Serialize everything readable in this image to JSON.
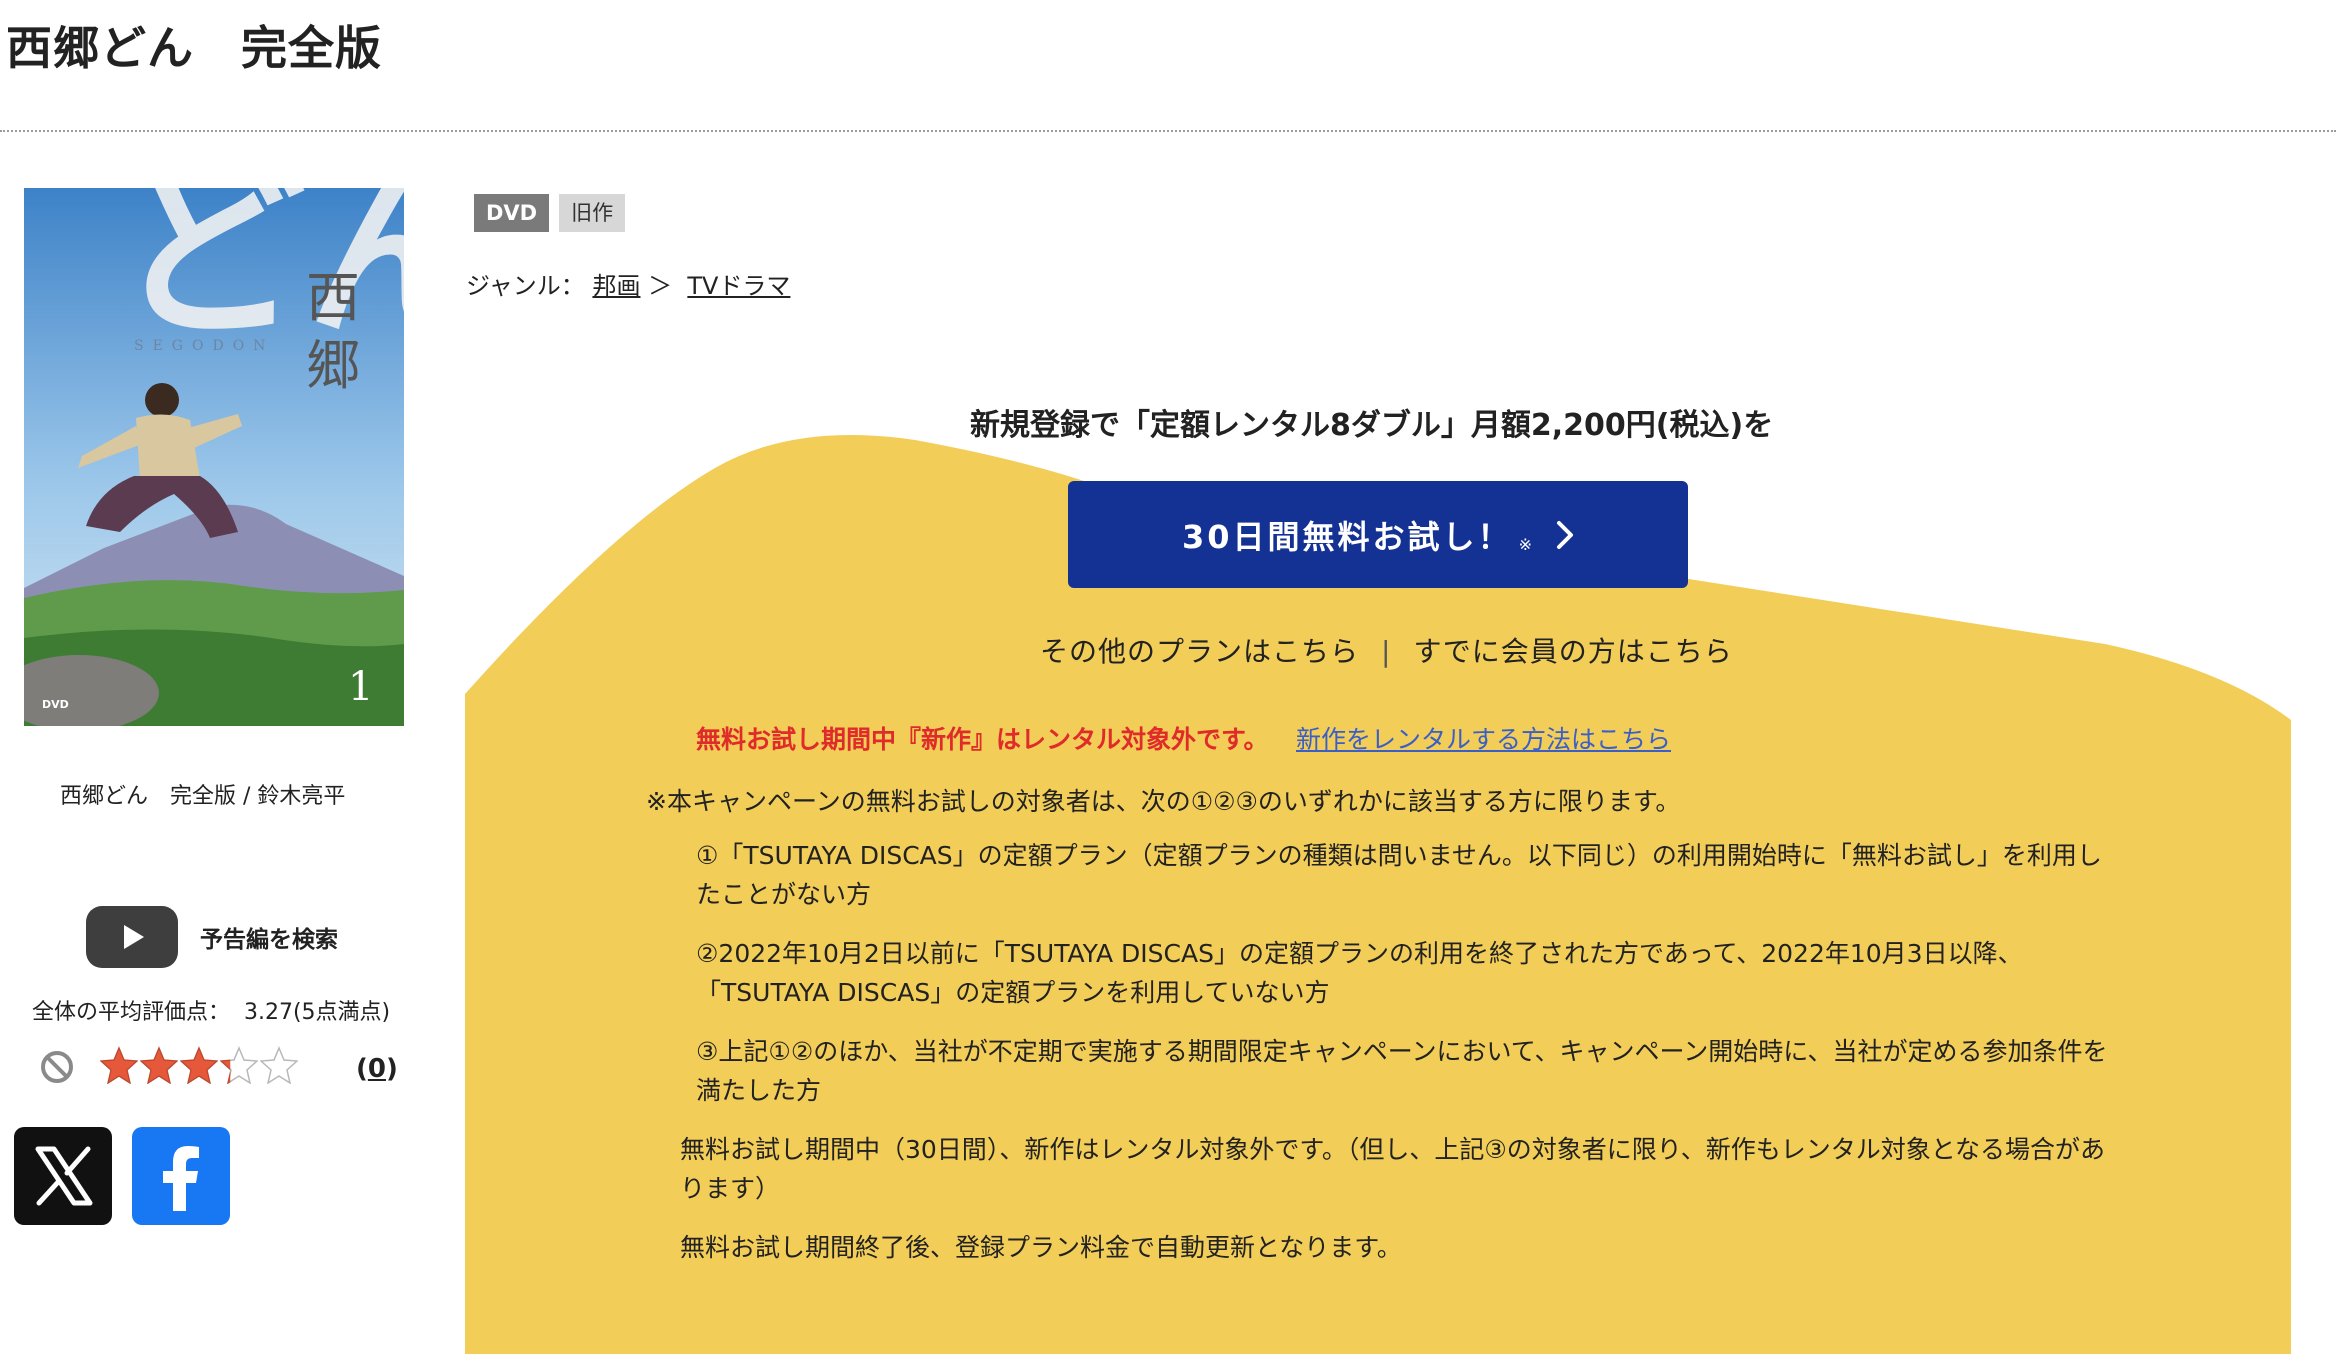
{
  "product": {
    "title": "西郷どん　完全版",
    "caption": "西郷どん　完全版 / 鈴木亮平",
    "cover": {
      "art_text_large": "どん",
      "art_text_vertical": [
        "西",
        "郷"
      ],
      "art_text_roman": "SEGODON",
      "volume": "1",
      "format_mark": "DVD"
    },
    "badges": [
      "DVD",
      "旧作"
    ]
  },
  "genre": {
    "label": "ジャンル：",
    "items": [
      "邦画",
      "TVドラマ"
    ],
    "separator": "＞"
  },
  "trailer": {
    "label": "予告編を検索"
  },
  "rating": {
    "line": "全体の平均評価点：  3.27(5点満点)",
    "value": 3.27,
    "max": 5,
    "review_count": "0"
  },
  "promo": {
    "headline": "新規登録で「定額レンタル8ダブル」月額2,200円(税込)を",
    "cta_label": "30日間無料お試し！",
    "cta_note": "※",
    "other_plans_link": "その他のプランはこちら",
    "separator": "|",
    "member_link": "すでに会員の方はこちら",
    "notice_red": "無料お試し期間中『新作』はレンタル対象外です。",
    "notice_link": "新作をレンタルする方法はこちら",
    "campaign_note": "※本キャンペーンの無料お試しの対象者は、次の①②③のいずれかに該当する方に限ります。",
    "conditions": [
      "①「TSUTAYA DISCAS」の定額プラン（定額プランの種類は問いません。以下同じ）の利用開始時に「無料お試し」を利用したことがない方",
      "②2022年10月2日以前に「TSUTAYA DISCAS」の定額プランの利用を終了された方であって、2022年10月3日以降、「TSUTAYA DISCAS」の定額プランを利用していない方",
      "③上記①②のほか、当社が不定期で実施する期間限定キャンペーンにおいて、キャンペーン開始時に、当社が定める参加条件を満たした方"
    ],
    "note_a": "無料お試し期間中（30日間）、新作はレンタル対象外です。（但し、上記③の対象者に限り、新作もレンタル対象となる場合があります）",
    "note_b": "無料お試し期間終了後、登録プラン料金で自動更新となります。"
  },
  "colors": {
    "promo_yellow": "#f2cd58",
    "cta_blue": "#143294",
    "notice_red": "#e02b2b",
    "link_blue": "#3b5fc6",
    "star_fill": "#e5593a",
    "badge_dvd": "#7a7a7a",
    "badge_old": "#d7d7d7"
  },
  "icons": {
    "trailer": "play-icon",
    "rating_reset": "prohibited-icon",
    "star": "star-icon",
    "share_x": "x-logo-icon",
    "share_facebook": "facebook-logo-icon",
    "cta_arrow": "chevron-right-icon"
  }
}
